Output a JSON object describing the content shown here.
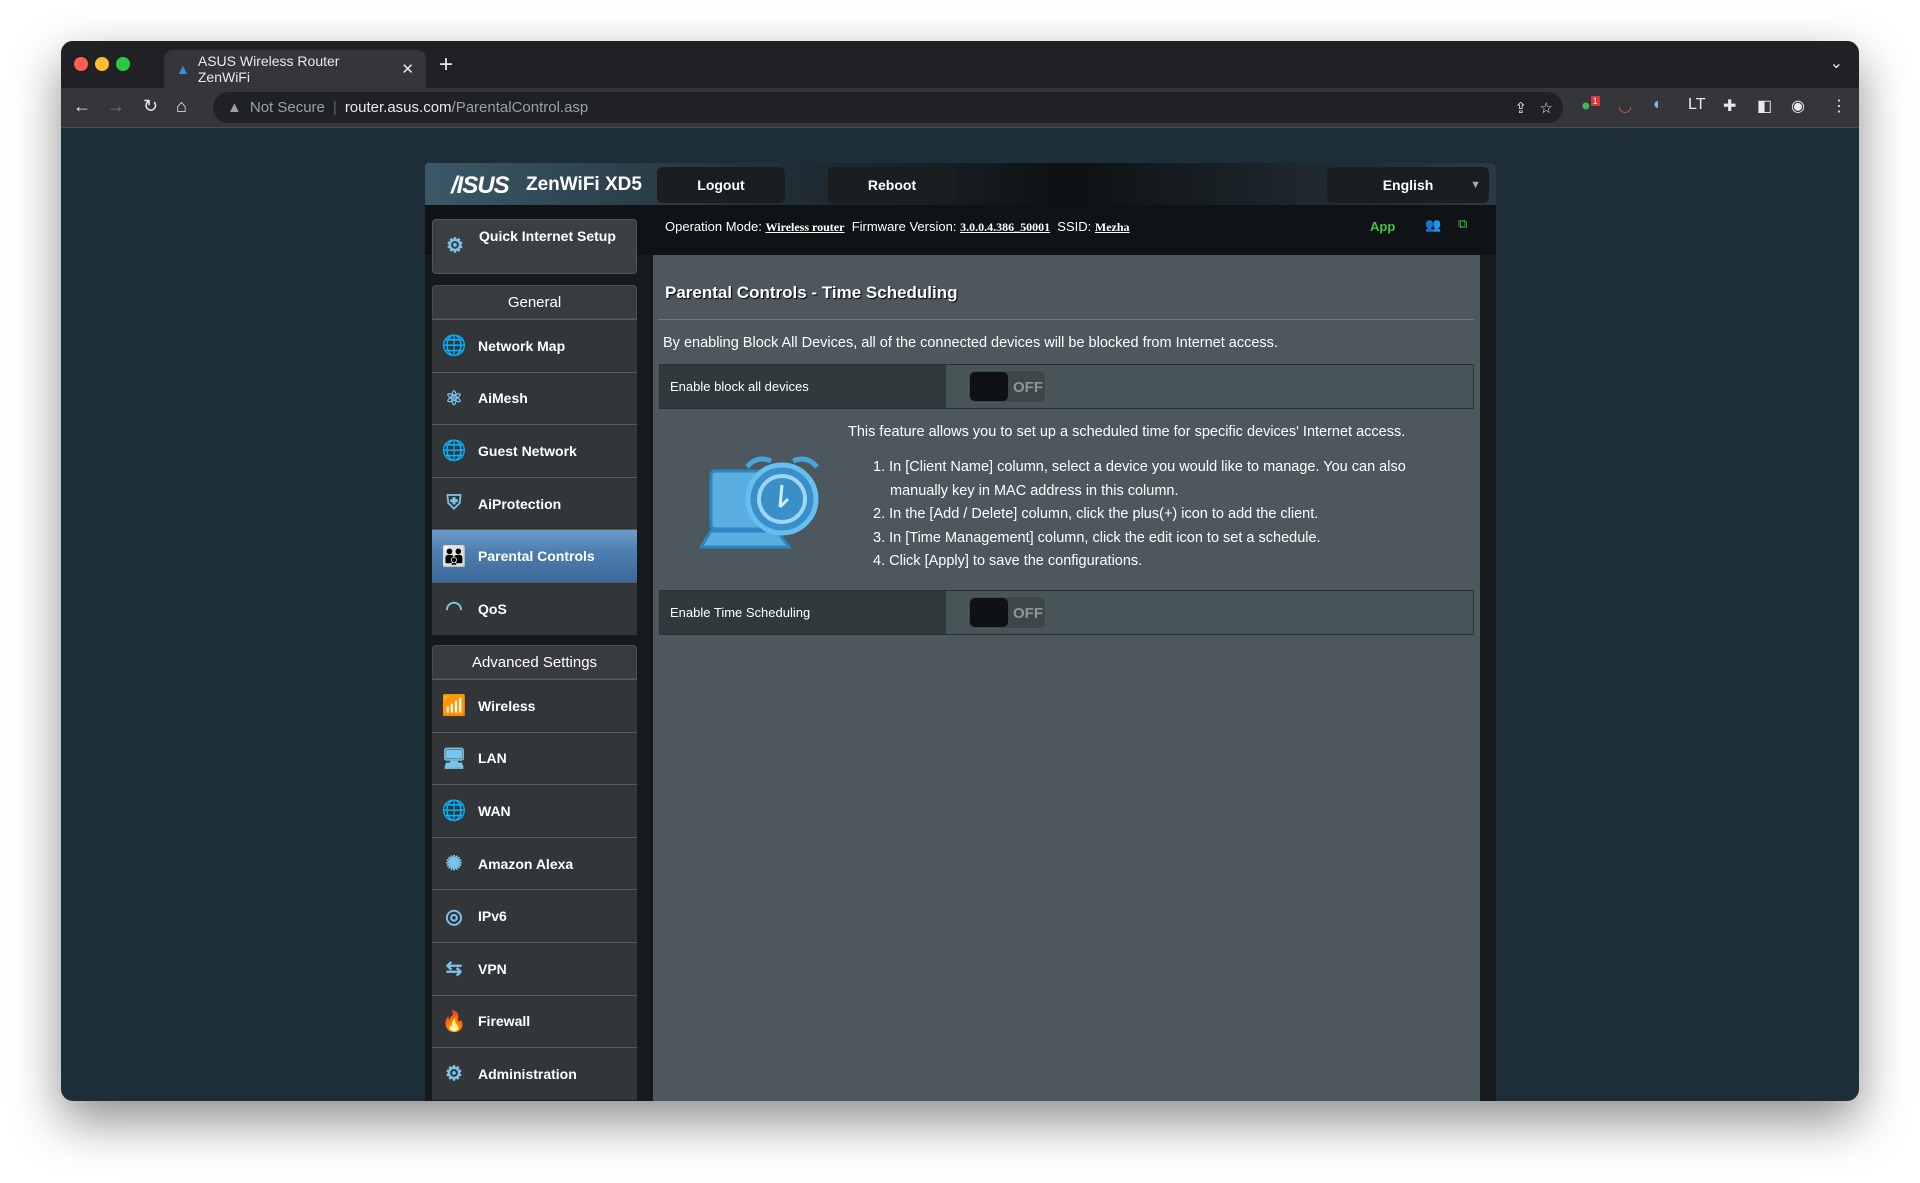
{
  "browser": {
    "tab_title": "ASUS Wireless Router ZenWiFi",
    "security": "Not Secure",
    "url_host": "router.asus.com",
    "url_path": "/ParentalControl.asp",
    "extension_badge": "1"
  },
  "header": {
    "logo": "/ISUS",
    "model": "ZenWiFi XD5",
    "logout": "Logout",
    "reboot": "Reboot",
    "language": "English"
  },
  "status": {
    "op_mode_label": "Operation Mode:",
    "op_mode": "Wireless router",
    "fw_label": "Firmware Version:",
    "fw": "3.0.0.4.386_50001",
    "ssid_label": "SSID:",
    "ssid": "Mezha",
    "app": "App"
  },
  "sidebar": {
    "quick_setup": "Quick Internet Setup",
    "general_title": "General",
    "general": [
      {
        "label": "Network Map",
        "icon": "globe-pin"
      },
      {
        "label": "AiMesh",
        "icon": "mesh"
      },
      {
        "label": "Guest Network",
        "icon": "globe-users"
      },
      {
        "label": "AiProtection",
        "icon": "shield-lock"
      },
      {
        "label": "Parental Controls",
        "icon": "family"
      },
      {
        "label": "QoS",
        "icon": "gauge"
      }
    ],
    "advanced_title": "Advanced Settings",
    "advanced": [
      {
        "label": "Wireless",
        "icon": "wifi"
      },
      {
        "label": "LAN",
        "icon": "monitor"
      },
      {
        "label": "WAN",
        "icon": "globe"
      },
      {
        "label": "Amazon Alexa",
        "icon": "alexa"
      },
      {
        "label": "IPv6",
        "icon": "ipv6"
      },
      {
        "label": "VPN",
        "icon": "vpn"
      },
      {
        "label": "Firewall",
        "icon": "fire"
      },
      {
        "label": "Administration",
        "icon": "admin"
      }
    ]
  },
  "content": {
    "title": "Parental Controls - Time Scheduling",
    "block_desc": "By enabling Block All Devices, all of the connected devices will be blocked from Internet access.",
    "block_label": "Enable block all devices",
    "block_state": "OFF",
    "feature_desc": "This feature allows you to set up a scheduled time for specific devices' Internet access.",
    "steps": [
      "1. In [Client Name] column, select a device you would like to manage. You can also manually key in MAC address in this column.",
      "2. In the [Add / Delete] column, click the plus(+) icon to add the client.",
      "3. In [Time Management] column, click the edit icon to set a schedule.",
      "4. Click [Apply] to save the configurations."
    ],
    "sched_label": "Enable Time Scheduling",
    "sched_state": "OFF"
  },
  "colors": {
    "accent": "#4f7fb0",
    "app_green": "#3fc53f"
  }
}
